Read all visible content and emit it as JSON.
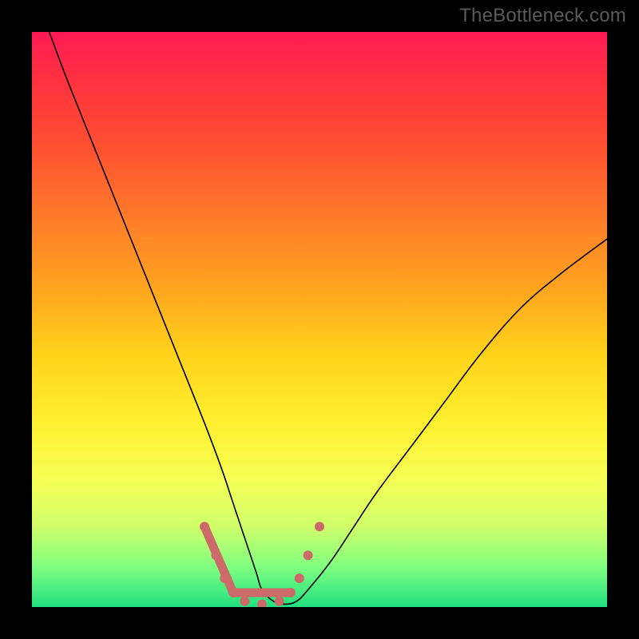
{
  "watermark": "TheBottleneck.com",
  "chart_data": {
    "type": "line",
    "title": "",
    "xlabel": "",
    "ylabel": "",
    "xlim": [
      0,
      100
    ],
    "ylim": [
      0,
      100
    ],
    "background": "rainbow-gradient",
    "series": [
      {
        "name": "bottleneck-curve",
        "x": [
          0,
          3,
          6,
          10,
          14,
          18,
          22,
          26,
          30,
          33,
          35,
          37,
          39,
          40,
          42,
          44,
          46,
          48,
          52,
          56,
          60,
          66,
          72,
          78,
          85,
          92,
          100
        ],
        "y": [
          108,
          100,
          92,
          82,
          72,
          62,
          52,
          42,
          32,
          24,
          18,
          12,
          6,
          3,
          1,
          0.5,
          1,
          3,
          8,
          14,
          20,
          28,
          36,
          44,
          52,
          58,
          64
        ]
      }
    ],
    "markers": {
      "name": "highlight-points",
      "color": "#cc6a6a",
      "points": [
        {
          "x": 30,
          "y": 14
        },
        {
          "x": 32,
          "y": 9
        },
        {
          "x": 33.5,
          "y": 5
        },
        {
          "x": 35,
          "y": 2.5
        },
        {
          "x": 37,
          "y": 1
        },
        {
          "x": 40,
          "y": 0.5
        },
        {
          "x": 43,
          "y": 1
        },
        {
          "x": 45,
          "y": 2.5
        },
        {
          "x": 46.5,
          "y": 5
        },
        {
          "x": 48,
          "y": 9
        },
        {
          "x": 50,
          "y": 14
        }
      ],
      "segments": [
        {
          "x1": 30,
          "y1": 14,
          "x2": 35,
          "y2": 2.5
        },
        {
          "x1": 35,
          "y1": 2.5,
          "x2": 45,
          "y2": 2.5
        }
      ]
    }
  }
}
